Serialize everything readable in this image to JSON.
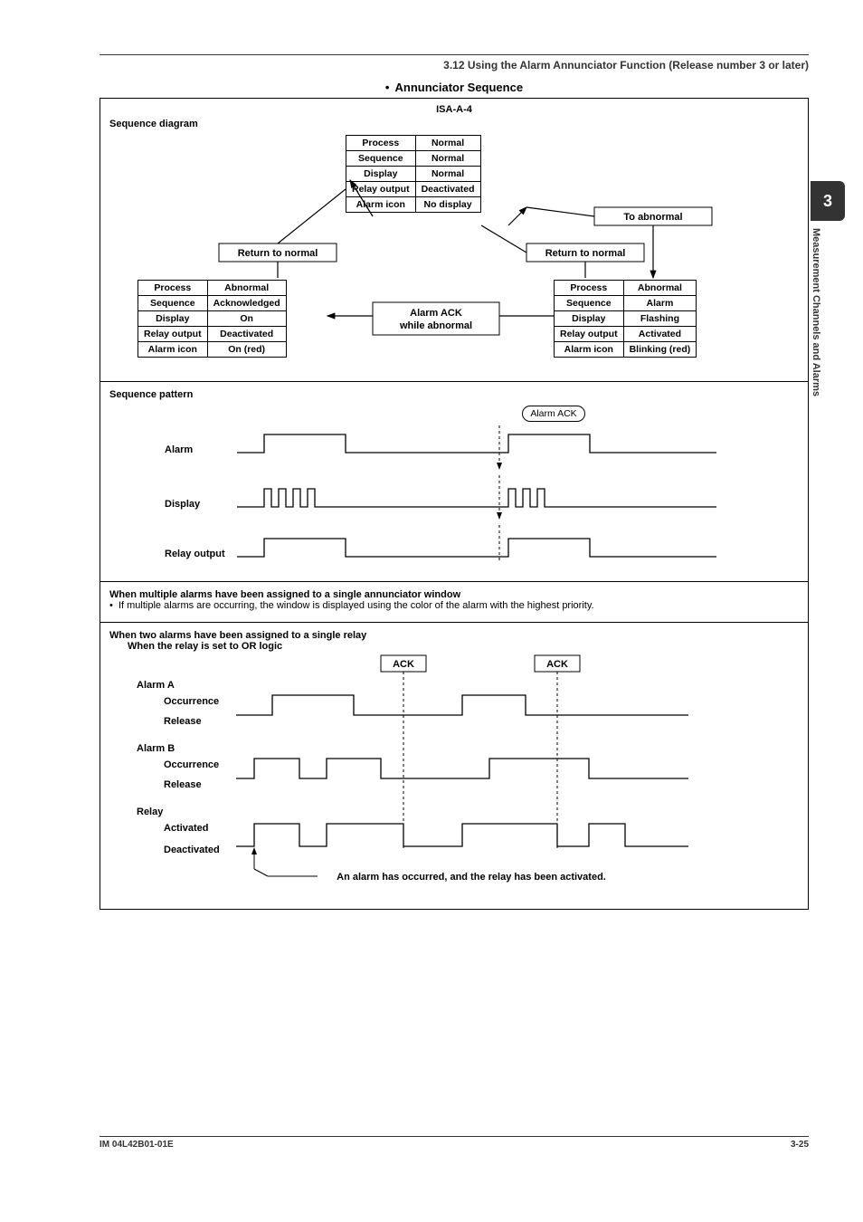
{
  "header": "3.12  Using the Alarm Annunciator Function (Release number 3 or later)",
  "bullet_title": "Annunciator Sequence",
  "isa": "ISA-A-4",
  "side_tab_num": "3",
  "side_tab_text": "Measurement Channels and Alarms",
  "seq_diagram_label": "Sequence diagram",
  "row_labels": [
    "Process",
    "Sequence",
    "Display",
    "Relay output",
    "Alarm icon"
  ],
  "state_normal": [
    "Normal",
    "Normal",
    "Normal",
    "Deactivated",
    "No display"
  ],
  "state_ack": [
    "Abnormal",
    "Acknowledged",
    "On",
    "Deactivated",
    "On (red)"
  ],
  "state_abn": [
    "Abnormal",
    "Alarm",
    "Flashing",
    "Activated",
    "Blinking (red)"
  ],
  "arrows": {
    "to_abnormal": "To abnormal",
    "return_normal": "Return to normal",
    "alarm_ack_while": "Alarm ACK while abnormal"
  },
  "seq_pattern_label": "Sequence pattern",
  "alarm_ack_round": "Alarm ACK",
  "pattern_rows": [
    "Alarm",
    "Display",
    "Relay output"
  ],
  "multi_heading": "When multiple alarms have been assigned to a single annunciator window",
  "multi_bullet": "If multiple alarms are occurring, the window is displayed using the color of the alarm with the highest priority.",
  "two_heading": "When two alarms have been assigned to a single relay",
  "or_logic": "When the relay is set to OR logic",
  "ack_box": "ACK",
  "alarm_a": "Alarm A",
  "alarm_b": "Alarm B",
  "occurrence": "Occurrence",
  "release": "Release",
  "relay_label": "Relay",
  "activated": "Activated",
  "deactivated": "Deactivated",
  "relay_note": "An alarm has occurred, and the relay has been activated.",
  "footer_left": "IM 04L42B01-01E",
  "footer_right": "3-25"
}
